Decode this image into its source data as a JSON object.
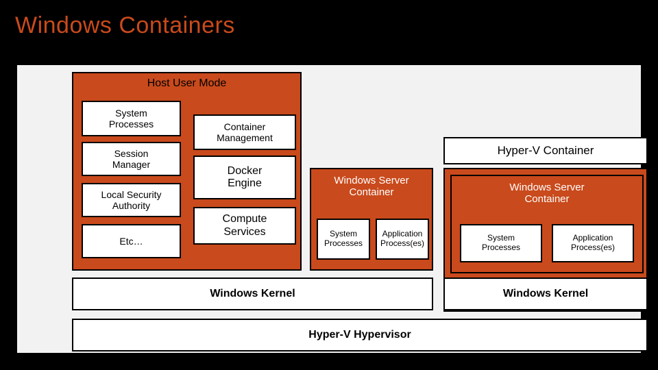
{
  "title": "Windows Containers",
  "host_user_mode": {
    "header": "Host User Mode",
    "system_processes": "System\nProcesses",
    "session_manager": "Session\nManager",
    "local_security_authority": "Local Security\nAuthority",
    "etc": "Etc…",
    "container_management": "Container\nManagement",
    "docker_engine": "Docker\nEngine",
    "compute_services": "Compute\nServices"
  },
  "wsc_left": {
    "title": "Windows Server\nContainer",
    "system_processes": "System\nProcesses",
    "application_processes": "Application\nProcess(es)"
  },
  "hyperv": {
    "title": "Hyper-V Container",
    "wsc": {
      "title": "Windows Server\nContainer",
      "system_processes": "System\nProcesses",
      "application_processes": "Application\nProcess(es)"
    },
    "kernel": "Windows Kernel"
  },
  "kernel_left": "Windows Kernel",
  "hypervisor": "Hyper-V Hypervisor"
}
